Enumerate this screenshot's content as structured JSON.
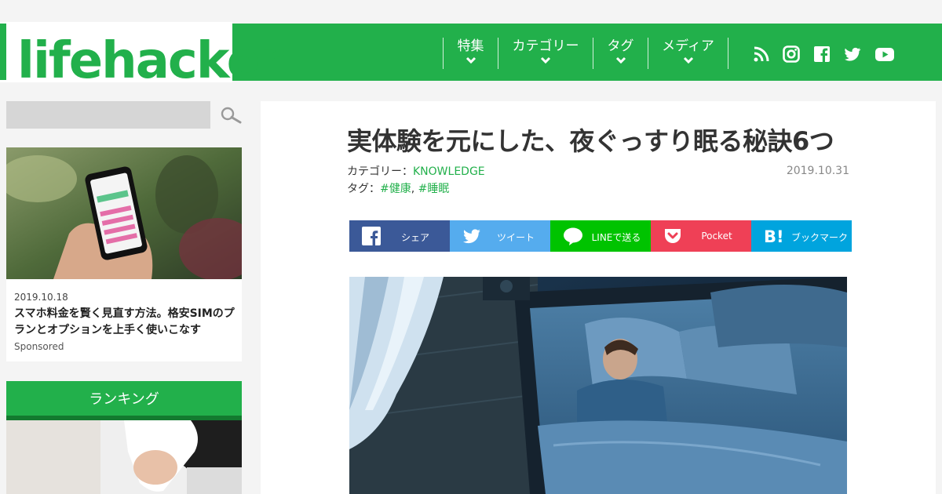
{
  "brand": {
    "logo": "lifehacker",
    "accent": "#22b04b"
  },
  "nav": {
    "items": [
      {
        "label": "特集"
      },
      {
        "label": "カテゴリー"
      },
      {
        "label": "タグ"
      },
      {
        "label": "メディア"
      }
    ],
    "social_icons": [
      "rss-icon",
      "instagram-icon",
      "facebook-icon",
      "twitter-icon",
      "youtube-icon"
    ]
  },
  "sidebar": {
    "search": {
      "placeholder": ""
    },
    "sponsored_card": {
      "date": "2019.10.18",
      "title": "スマホ料金を賢く見直す方法。格安SIMのプランとオプションを上手く使いこなす",
      "label": "Sponsored"
    },
    "ranking": {
      "heading": "ランキング"
    }
  },
  "article": {
    "title": "実体験を元にした、夜ぐっすり眠る秘訣6つ",
    "category_label": "カテゴリー：",
    "category": "KNOWLEDGE",
    "tags_label": "タグ：",
    "tag1": "#健康",
    "tag_sep": ",",
    "tag2": "#睡眠",
    "date": "2019.10.31"
  },
  "share": [
    {
      "label": "シェア",
      "color": "#3b5998",
      "icon": "facebook-icon"
    },
    {
      "label": "ツイート",
      "color": "#55acee",
      "icon": "twitter-icon"
    },
    {
      "label": "LINEで送る",
      "color": "#00c300",
      "icon": "line-icon"
    },
    {
      "label": "Pocket",
      "color": "#ef4056",
      "icon": "pocket-icon"
    },
    {
      "label": "ブックマーク",
      "color": "#00a4de",
      "icon": "hatena-bookmark-icon"
    }
  ]
}
